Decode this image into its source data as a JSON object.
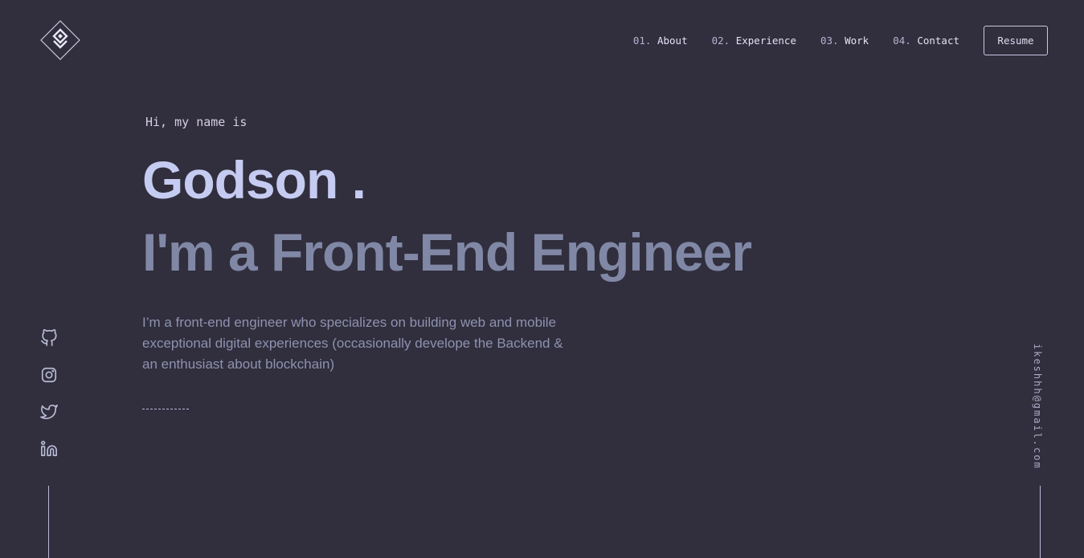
{
  "brand": {
    "logo_icon": "diamond-logo-icon"
  },
  "nav": {
    "items": [
      {
        "num": "01.",
        "label": "About"
      },
      {
        "num": "02.",
        "label": "Experience"
      },
      {
        "num": "03.",
        "label": "Work"
      },
      {
        "num": "04.",
        "label": "Contact"
      }
    ],
    "resume_label": "Resume"
  },
  "hero": {
    "greeting": "Hi, my name is",
    "name": "Godson .",
    "tagline": "I'm a Front-End Engineer",
    "description": "I’m a front-end engineer who specializes on building web and mobile exceptional digital experiences (occasionally develope the Backend & an enthusiast about blockchain)"
  },
  "socials": [
    {
      "icon": "github-icon"
    },
    {
      "icon": "instagram-icon"
    },
    {
      "icon": "twitter-icon"
    },
    {
      "icon": "linkedin-icon"
    }
  ],
  "email": "ikeshhh@gmail.com",
  "colors": {
    "background": "#312e3d",
    "name": "#c5cbf1",
    "tagline": "#8088a6",
    "description": "#8e92b0"
  }
}
